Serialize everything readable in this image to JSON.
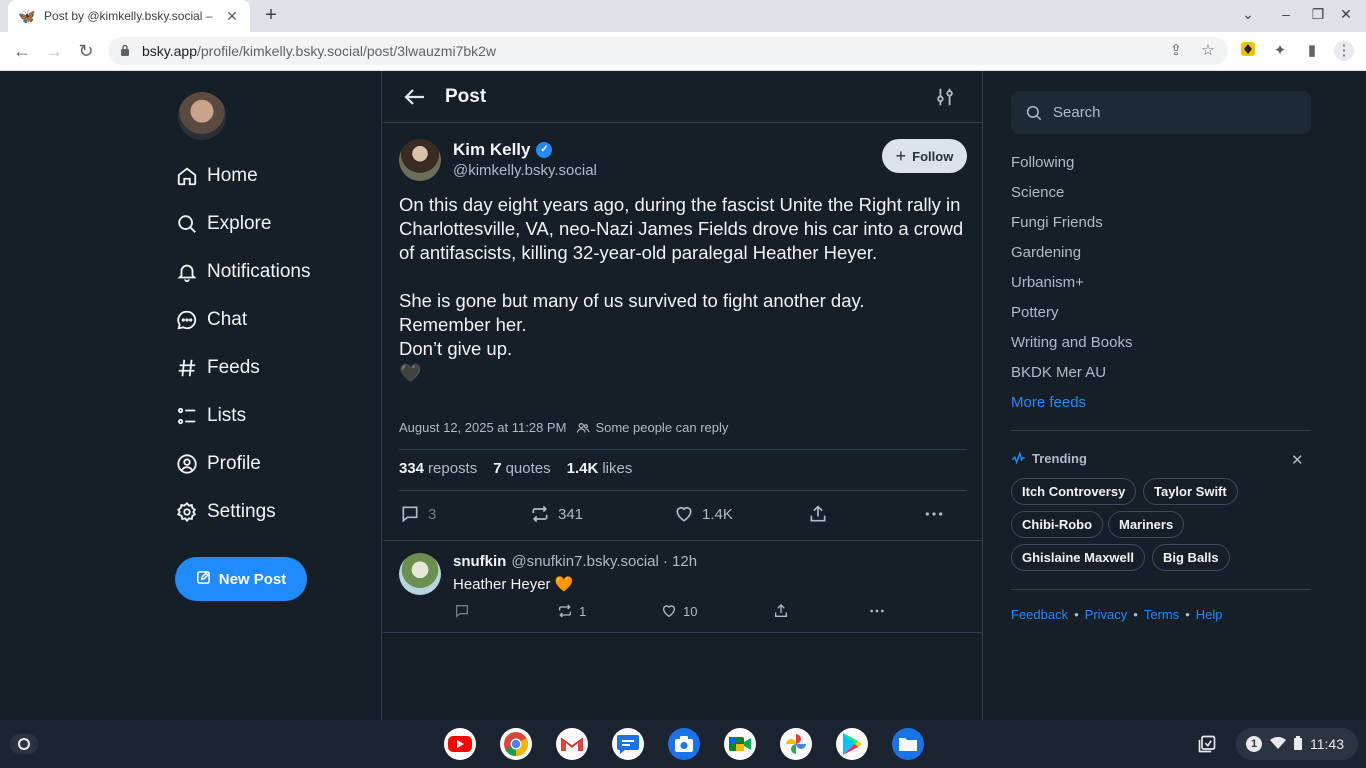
{
  "browser": {
    "tab_title": "Post by @kimkelly.bsky.social –",
    "url_host": "bsky.app",
    "url_path": "/profile/kimkelly.bsky.social/post/3lwauzmi7bk2w"
  },
  "nav": {
    "items": [
      {
        "label": "Home",
        "icon": "home-icon"
      },
      {
        "label": "Explore",
        "icon": "search-icon"
      },
      {
        "label": "Notifications",
        "icon": "bell-icon"
      },
      {
        "label": "Chat",
        "icon": "chat-icon"
      },
      {
        "label": "Feeds",
        "icon": "hash-icon"
      },
      {
        "label": "Lists",
        "icon": "list-icon"
      },
      {
        "label": "Profile",
        "icon": "user-circle-icon"
      },
      {
        "label": "Settings",
        "icon": "gear-icon"
      }
    ],
    "new_post": "New Post"
  },
  "header": {
    "title": "Post"
  },
  "post": {
    "author_name": "Kim Kelly",
    "author_handle": "@kimkelly.bsky.social",
    "follow_label": "Follow",
    "paragraph1": "On this day eight years ago, during the fascist Unite the Right rally in Charlottesville, VA, neo-Nazi James Fields drove his car into a crowd of antifascists, killing 32-year-old paralegal Heather Heyer.",
    "line2": "She is gone but many of us survived to fight another day.",
    "line3": "Remember her.",
    "line4": "Don’t give up.",
    "emoji": "🖤",
    "timestamp": "August 12, 2025 at 11:28 PM",
    "reply_setting": "Some people can reply",
    "reposts_count": "334",
    "reposts_label": "reposts",
    "quotes_count": "7",
    "quotes_label": "quotes",
    "likes_count": "1.4K",
    "likes_label": "likes",
    "reply_action": "3",
    "repost_action": "341",
    "like_action": "1.4K"
  },
  "reply": {
    "name": "snufkin",
    "handle": "@snufkin7.bsky.social",
    "time": "· 12h",
    "text": "Heather Heyer 🧡",
    "replies": "",
    "reposts": "1",
    "likes": "10"
  },
  "sidebar": {
    "search_placeholder": "Search",
    "feeds": [
      "Following",
      "Science",
      "Fungi Friends",
      "Gardening",
      "Urbanism+",
      "Pottery",
      "Writing and Books",
      "BKDK Mer AU"
    ],
    "more_feeds": "More feeds",
    "trending_label": "Trending",
    "trending": [
      "Itch Controversy",
      "Taylor Swift",
      "Chibi-Robo",
      "Mariners",
      "Ghislaine Maxwell",
      "Big Balls"
    ],
    "footer": [
      "Feedback",
      "Privacy",
      "Terms",
      "Help"
    ]
  },
  "shelf": {
    "apps": [
      "youtube-icon",
      "chrome-icon",
      "gmail-icon",
      "messages-icon",
      "camera-icon",
      "meet-icon",
      "photos-icon",
      "play-store-icon",
      "files-icon"
    ],
    "notification_count": "1",
    "time": "11:43"
  }
}
